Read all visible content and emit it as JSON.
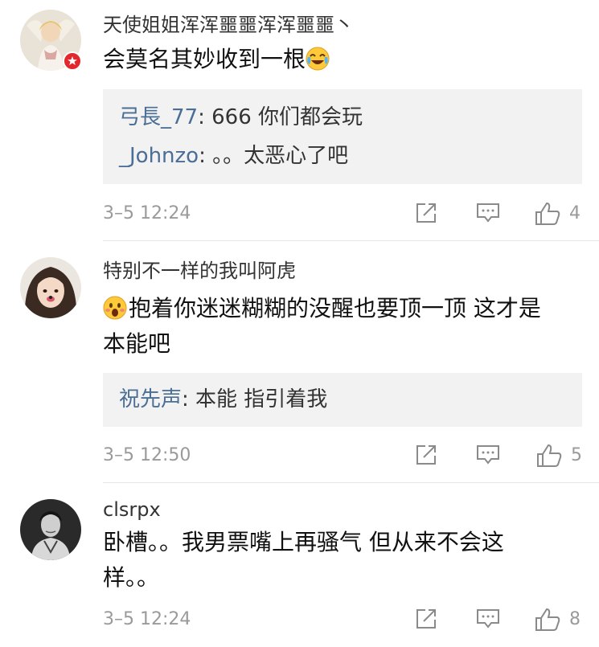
{
  "comments": [
    {
      "username": "天使姐姐浑浑噩噩浑浑噩噩丶",
      "content_lines": [
        "会莫名其妙收到一根"
      ],
      "emoji": "laughing-crying-emoji",
      "replies": [
        {
          "name": "弓長_77",
          "text": ": 666  你们都会玩"
        },
        {
          "name": "_Johnzo",
          "text": ": 。。太恶心了吧"
        }
      ],
      "time": "3–5 12:24",
      "likes": "4"
    },
    {
      "username": "特别不一样的我叫阿虎",
      "content_lines": [
        "抱着你迷迷糊糊的没醒也要顶一顶 这才是",
        "本能吧"
      ],
      "emoji": "shocked-emoji",
      "replies": [
        {
          "name": "祝先声",
          "text": ": 本能 指引着我"
        }
      ],
      "time": "3–5 12:50",
      "likes": "5"
    },
    {
      "username": "clsrpx",
      "content_lines": [
        "卧槽。。我男票嘴上再骚气 但从来不会这",
        "样。。"
      ],
      "replies": [],
      "time": "3–5 12:24",
      "likes": "8"
    }
  ],
  "icons": {
    "repost": "repost-icon",
    "comment": "comment-icon",
    "like": "like-icon"
  },
  "colors": {
    "reply_name": "#4a6e96",
    "reply_bg": "#f2f2f2",
    "meta_text": "#9a9a9a",
    "badge": "#e2282d"
  }
}
